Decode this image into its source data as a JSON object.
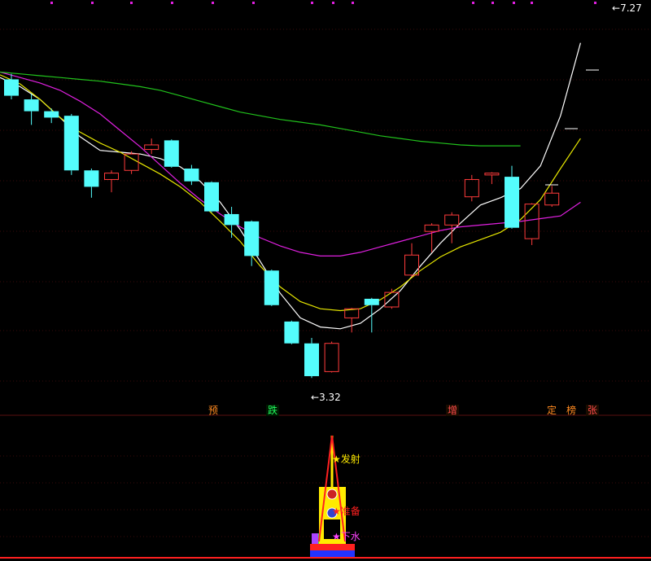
{
  "colors": {
    "background": "#000000",
    "grid": "#3a0a0a",
    "bear_candle": "#54fcfc",
    "bull_candle": "#ff3b3b",
    "ma_white": "#ffffff",
    "ma_yellow": "#e6e600",
    "ma_magenta": "#e020e0",
    "ma_green": "#21c21c",
    "signal_gold": "#ffeb00",
    "signal_red": "#ff0000",
    "signal_blue": "#2233ff",
    "signal_magenta": "#ff44ff"
  },
  "chart_data": [
    {
      "type": "candlestick",
      "title": "",
      "xlabel": "",
      "ylabel": "",
      "ylim": [
        3.0,
        7.4
      ],
      "grid": true,
      "legend": "none",
      "candles": [
        {
          "open": 6.6,
          "close": 6.42,
          "high": 6.66,
          "low": 6.38
        },
        {
          "open": 6.38,
          "close": 6.25,
          "high": 6.44,
          "low": 6.1
        },
        {
          "open": 6.25,
          "close": 6.18,
          "high": 6.28,
          "low": 6.12
        },
        {
          "open": 6.2,
          "close": 5.6,
          "high": 6.22,
          "low": 5.55
        },
        {
          "open": 5.6,
          "close": 5.42,
          "high": 5.62,
          "low": 5.3
        },
        {
          "open": 5.5,
          "close": 5.57,
          "high": 5.6,
          "low": 5.36
        },
        {
          "open": 5.6,
          "close": 5.78,
          "high": 5.81,
          "low": 5.56
        },
        {
          "open": 5.83,
          "close": 5.88,
          "high": 5.95,
          "low": 5.78
        },
        {
          "open": 5.93,
          "close": 5.64,
          "high": 5.94,
          "low": 5.63
        },
        {
          "open": 5.62,
          "close": 5.48,
          "high": 5.66,
          "low": 5.44
        },
        {
          "open": 5.47,
          "close": 5.15,
          "high": 5.48,
          "low": 5.14
        },
        {
          "open": 5.12,
          "close": 5.0,
          "high": 5.2,
          "low": 4.86
        },
        {
          "open": 5.04,
          "close": 4.66,
          "high": 5.05,
          "low": 4.55
        },
        {
          "open": 4.5,
          "close": 4.12,
          "high": 4.51,
          "low": 4.11
        },
        {
          "open": 3.94,
          "close": 3.7,
          "high": 3.95,
          "low": 3.69
        },
        {
          "open": 3.7,
          "close": 3.34,
          "high": 3.76,
          "low": 3.32
        },
        {
          "open": 3.39,
          "close": 3.7,
          "high": 3.72,
          "low": 3.38
        },
        {
          "open": 3.98,
          "close": 4.08,
          "high": 4.09,
          "low": 3.82
        },
        {
          "open": 4.19,
          "close": 4.12,
          "high": 4.2,
          "low": 3.82
        },
        {
          "open": 4.1,
          "close": 4.26,
          "high": 4.3,
          "low": 4.08
        },
        {
          "open": 4.45,
          "close": 4.67,
          "high": 4.8,
          "low": 4.43
        },
        {
          "open": 4.93,
          "close": 5.0,
          "high": 5.02,
          "low": 4.7
        },
        {
          "open": 5.0,
          "close": 5.11,
          "high": 5.14,
          "low": 4.8
        },
        {
          "open": 5.31,
          "close": 5.5,
          "high": 5.55,
          "low": 5.26
        },
        {
          "open": 5.55,
          "close": 5.57,
          "high": 5.58,
          "low": 5.45
        },
        {
          "open": 5.53,
          "close": 4.97,
          "high": 5.65,
          "low": 4.96
        },
        {
          "open": 4.85,
          "close": 5.23,
          "high": 5.24,
          "low": 4.78
        },
        {
          "open": 5.22,
          "close": 5.35,
          "high": 5.43,
          "low": 5.2
        }
      ],
      "moving_averages": [
        {
          "color": "#ffffff",
          "values": [
            6.62,
            6.52,
            6.38,
            6.18,
            5.97,
            5.82,
            5.8,
            5.78,
            5.73,
            5.64,
            5.48,
            5.25,
            4.95,
            4.6,
            4.25,
            3.98,
            3.88,
            3.86,
            3.92,
            4.08,
            4.28,
            4.55,
            4.8,
            5.02,
            5.22,
            5.3,
            5.4,
            5.65,
            6.2,
            7.0
          ]
        },
        {
          "color": "#e6e600",
          "values": [
            6.65,
            6.55,
            6.38,
            6.18,
            6.02,
            5.9,
            5.8,
            5.68,
            5.56,
            5.42,
            5.25,
            5.04,
            4.82,
            4.55,
            4.32,
            4.16,
            4.08,
            4.06,
            4.08,
            4.18,
            4.32,
            4.5,
            4.65,
            4.76,
            4.84,
            4.92,
            5.06,
            5.28,
            5.62,
            5.95
          ]
        },
        {
          "color": "#e020e0",
          "values": [
            6.68,
            6.62,
            6.56,
            6.48,
            6.36,
            6.22,
            6.04,
            5.86,
            5.66,
            5.46,
            5.28,
            5.12,
            4.98,
            4.86,
            4.77,
            4.7,
            4.66,
            4.66,
            4.7,
            4.76,
            4.82,
            4.88,
            4.94,
            4.98,
            5.0,
            5.02,
            5.04,
            5.07,
            5.1,
            5.25
          ]
        },
        {
          "color": "#21c21c",
          "values": [
            6.68,
            6.66,
            6.64,
            6.62,
            6.6,
            6.58,
            6.55,
            6.52,
            6.48,
            6.42,
            6.36,
            6.3,
            6.24,
            6.2,
            6.16,
            6.13,
            6.1,
            6.06,
            6.02,
            5.98,
            5.95,
            5.92,
            5.9,
            5.88,
            5.87,
            5.87,
            5.87
          ]
        }
      ],
      "annotations": {
        "high_marker": "7.27",
        "low_marker": "3.32",
        "arrow_high": "←",
        "arrow_low": "←"
      },
      "signal_tags": [
        {
          "text": "预",
          "candle": 10,
          "style": "fixed"
        },
        {
          "text": "跌",
          "candle": 13,
          "style": "fall"
        },
        {
          "text": "增",
          "candle": 22,
          "style": "up"
        },
        {
          "text": "定",
          "candle": 27,
          "style": "fixed"
        },
        {
          "text": "榜",
          "candle": 28,
          "style": "fixed"
        },
        {
          "text": "张",
          "candle": 29,
          "style": "up"
        }
      ]
    },
    {
      "type": "signal_indicator",
      "labels": {
        "launch": "★发射",
        "ready": "★准备",
        "water": "★下水"
      }
    }
  ]
}
